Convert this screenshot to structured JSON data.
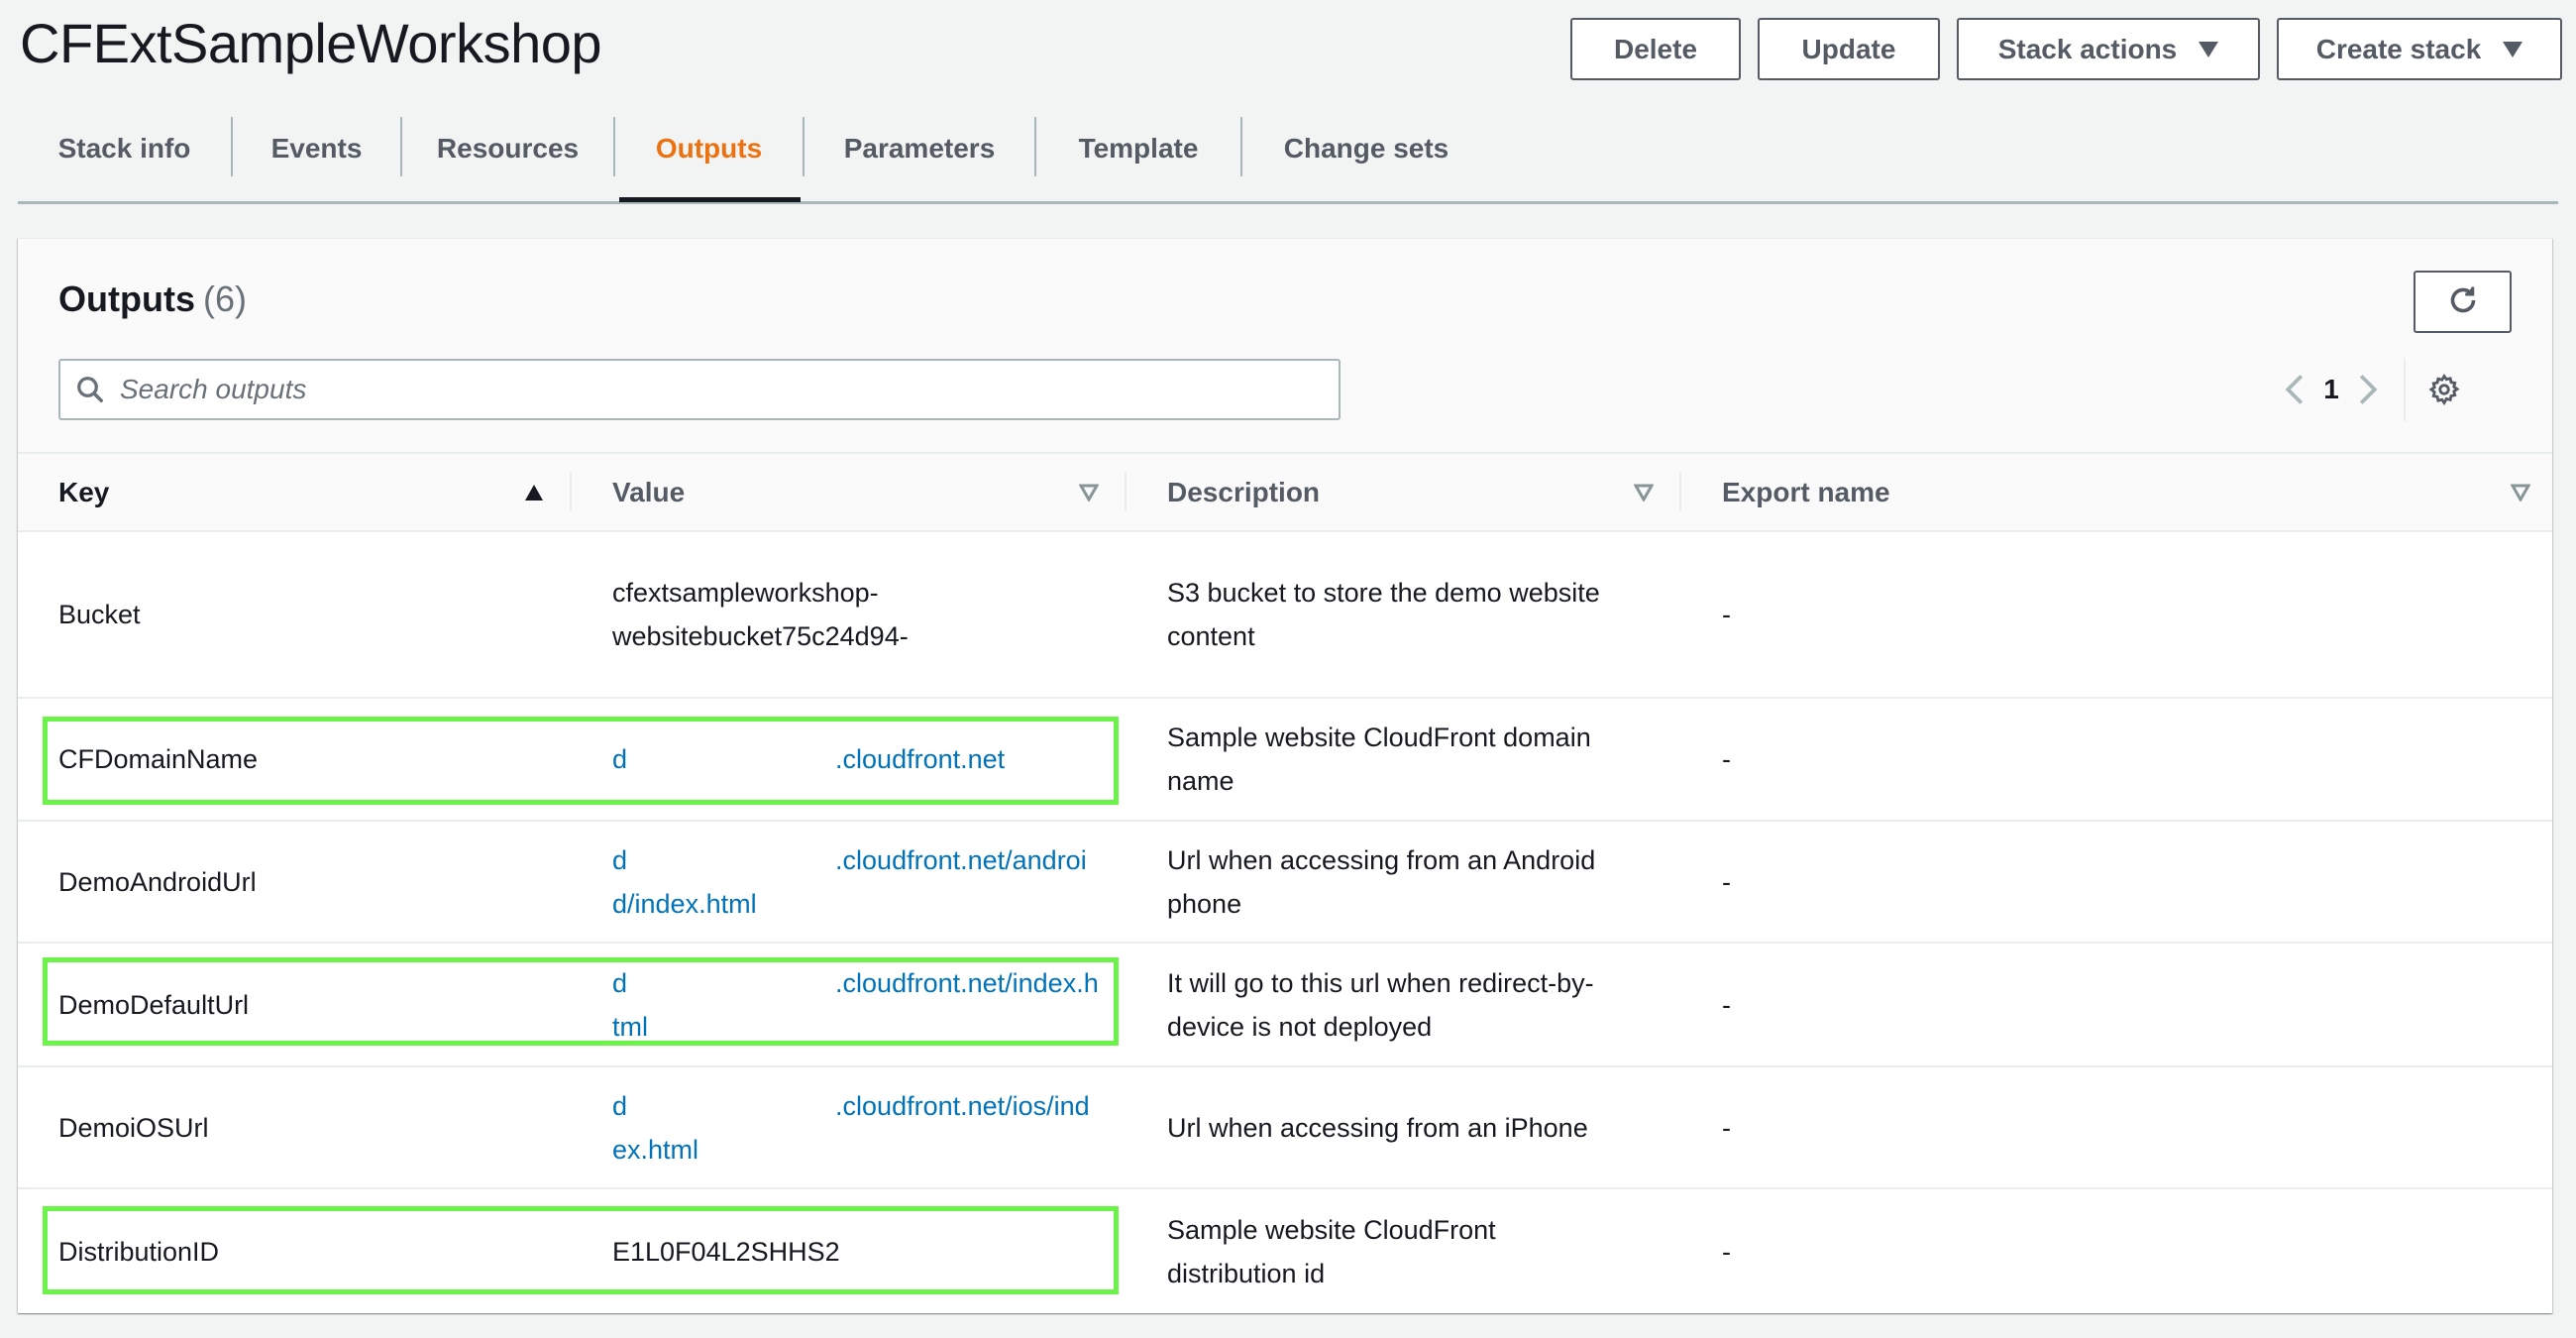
{
  "header": {
    "title": "CFExtSampleWorkshop",
    "actions": {
      "delete": "Delete",
      "update": "Update",
      "stack_actions": "Stack actions",
      "create_stack": "Create stack"
    }
  },
  "tabs": [
    {
      "label": "Stack info",
      "active": false
    },
    {
      "label": "Events",
      "active": false
    },
    {
      "label": "Resources",
      "active": false
    },
    {
      "label": "Outputs",
      "active": true
    },
    {
      "label": "Parameters",
      "active": false
    },
    {
      "label": "Template",
      "active": false
    },
    {
      "label": "Change sets",
      "active": false
    }
  ],
  "outputs": {
    "title": "Outputs",
    "count": "(6)",
    "search_placeholder": "Search outputs",
    "search_value": "",
    "pagination": {
      "current_page": "1"
    },
    "columns": [
      "Key",
      "Value",
      "Description",
      "Export name"
    ],
    "sort": {
      "column": "Key",
      "direction": "ascending"
    },
    "rows": [
      {
        "key": "Bucket",
        "value_prefix": "cfextsampleworkshop-websitebucket75c24d94-",
        "value_redacted": false,
        "value_is_link": false,
        "description": "S3 bucket to store the demo website content",
        "export_name": "-",
        "highlighted": false
      },
      {
        "key": "CFDomainName",
        "value_prefix": "d",
        "value_suffix": ".cloudfront.net",
        "value_redacted": true,
        "value_is_link": true,
        "description": "Sample website CloudFront domain name",
        "export_name": "-",
        "highlighted": true
      },
      {
        "key": "DemoAndroidUrl",
        "value_prefix": "d",
        "value_suffix": ".cloudfront.net/android/index.html",
        "value_redacted": true,
        "value_is_link": true,
        "description": "Url when accessing from an Android phone",
        "export_name": "-",
        "highlighted": false
      },
      {
        "key": "DemoDefaultUrl",
        "value_prefix": "d",
        "value_suffix": ".cloudfront.net/index.html",
        "value_redacted": true,
        "value_is_link": true,
        "description": "It will go to this url when redirect-by-device is not deployed",
        "export_name": "-",
        "highlighted": true
      },
      {
        "key": "DemoiOSUrl",
        "value_prefix": "d",
        "value_suffix": ".cloudfront.net/ios/index.html",
        "value_redacted": true,
        "value_is_link": true,
        "description": "Url when accessing from an iPhone",
        "export_name": "-",
        "highlighted": false
      },
      {
        "key": "DistributionID",
        "value_prefix": "E1L0F04L2SHHS2",
        "value_redacted": false,
        "value_is_link": false,
        "description": "Sample website CloudFront distribution id",
        "export_name": "-",
        "highlighted": true
      }
    ]
  },
  "colors": {
    "page_bg": "#f2f3f3",
    "active_tab": "#ec7211",
    "link": "#0073bb",
    "text": "#16191f",
    "muted_text": "#545b64",
    "highlight_box": "#6cf34a"
  },
  "icons": {
    "refresh": "refresh-icon",
    "search": "search-icon",
    "prev_page": "chevron-left-icon",
    "next_page": "chevron-right-icon",
    "settings": "gear-icon",
    "dropdown": "caret-down-icon",
    "sort_asc": "sort-ascending-icon",
    "filter": "sort-descending-outline-icon"
  }
}
